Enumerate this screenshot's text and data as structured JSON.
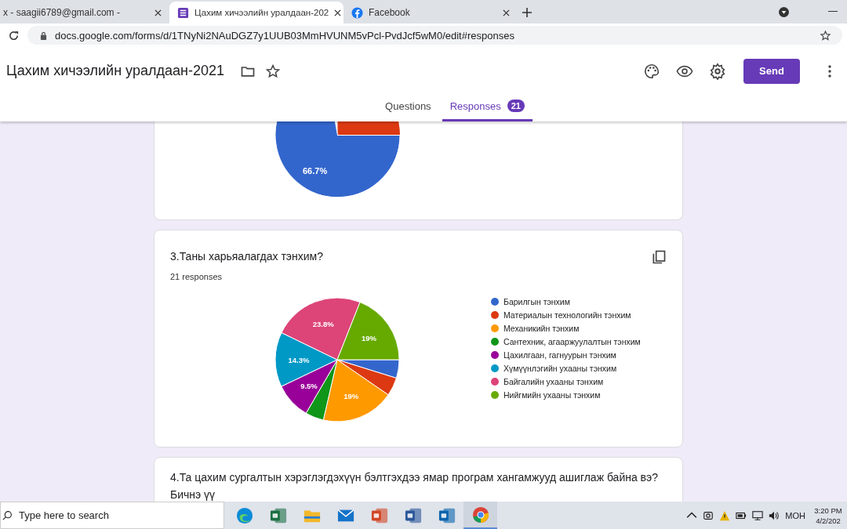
{
  "browser_tabs": [
    {
      "title": "x - saagii6789@gmail.com -",
      "kind": "mail",
      "selected": false
    },
    {
      "title": "Цахим хичээлийн уралдаан-202",
      "kind": "forms",
      "selected": true
    },
    {
      "title": "Facebook",
      "kind": "facebook",
      "selected": false
    }
  ],
  "address_bar": {
    "url": "docs.google.com/forms/d/1TNyNi2NAuDGZ7y1UUB03MmHVUNM5vPcl-PvdJcf5wM0/edit#responses"
  },
  "form_header": {
    "title": "Цахим хичээлийн уралдаан-2021",
    "send_button": "Send"
  },
  "form_tabs": [
    {
      "label": "Questions",
      "selected": false
    },
    {
      "label": "Responses",
      "badge": "21",
      "selected": true
    }
  ],
  "top_card": {
    "slice_label": "66.7%"
  },
  "question_3": {
    "title": "3.Таны харьяалагдах тэнхим?",
    "responses": "21 responses",
    "chart_data": {
      "type": "pie",
      "legend": "right",
      "value_labels": [
        null,
        null,
        "19%",
        null,
        "9.5%",
        "14.3%",
        "23.8%",
        "19%"
      ],
      "categories": [
        "Барилгын тэнхим",
        "Материалын технологийн тэнхим",
        "Механикийн тэнхим",
        "Сантехник, агааржуулалтын тэнхим",
        "Цахилгаан, гагнуурын тэнхим",
        "Хүмүүнлэгийн ухааны тэнхим",
        "Байгалийн ухааны тэнхим",
        "Нийгмийн ухааны тэнхим"
      ],
      "colors": [
        "#3366cc",
        "#dc3912",
        "#ff9900",
        "#109618",
        "#990099",
        "#0099c6",
        "#dd4477",
        "#66aa00"
      ],
      "values": [
        4.8,
        4.8,
        19,
        4.8,
        9.5,
        14.3,
        23.8,
        19
      ]
    }
  },
  "question_4": {
    "title": "4.Та цахим сургалтын хэрэглэгдэхүүн бэлтгэхдээ ямар програм хангамжууд ашиглаж байна вэ? Бичнэ үү"
  },
  "taskbar": {
    "search_placeholder": "Type here to search",
    "apps": [
      {
        "kind": "edge",
        "selected": false
      },
      {
        "kind": "excel",
        "selected": false
      },
      {
        "kind": "explorer",
        "selected": false
      },
      {
        "kind": "mail",
        "selected": false
      },
      {
        "kind": "powerpoint",
        "selected": false
      },
      {
        "kind": "word",
        "selected": false
      },
      {
        "kind": "outlook",
        "selected": false
      },
      {
        "kind": "chrome",
        "selected": true
      }
    ],
    "language": "МОН",
    "time": "3:20 PM",
    "date": "4/2/202"
  }
}
